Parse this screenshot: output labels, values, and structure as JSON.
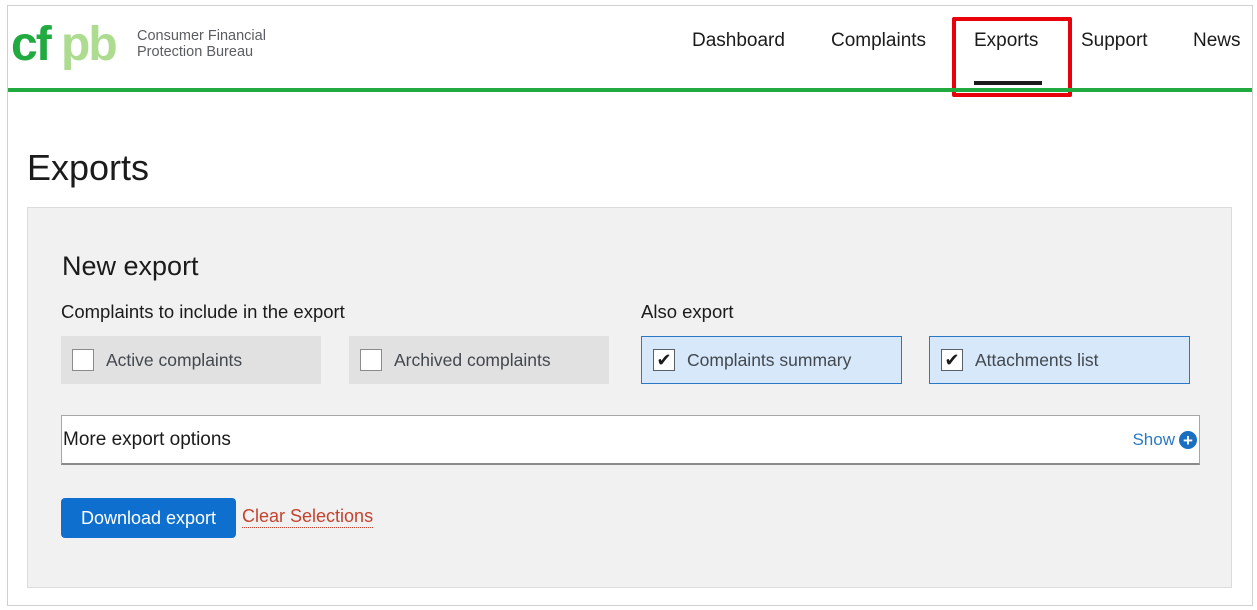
{
  "brand": {
    "logo_text": "cfpb",
    "name_line1": "Consumer Financial",
    "name_line2": "Protection Bureau",
    "colors": {
      "green": "#20aa3f",
      "light_green": "#addc91"
    }
  },
  "nav": {
    "items": [
      {
        "label": "Dashboard"
      },
      {
        "label": "Complaints"
      },
      {
        "label": "Exports",
        "active": true
      },
      {
        "label": "Support"
      },
      {
        "label": "News"
      }
    ],
    "highlight_color": "#e8000b"
  },
  "page": {
    "title": "Exports"
  },
  "new_export": {
    "title": "New export",
    "complaints_group": {
      "label": "Complaints to include in the export",
      "options": [
        {
          "label": "Active complaints",
          "checked": false
        },
        {
          "label": "Archived complaints",
          "checked": false
        }
      ]
    },
    "also_group": {
      "label": "Also export",
      "options": [
        {
          "label": "Complaints summary",
          "checked": true
        },
        {
          "label": "Attachments list",
          "checked": true
        }
      ]
    },
    "more_options": {
      "label": "More export options",
      "toggle": "Show",
      "icon": "plus-circle-icon"
    },
    "download_label": "Download export",
    "clear_label": "Clear Selections"
  }
}
